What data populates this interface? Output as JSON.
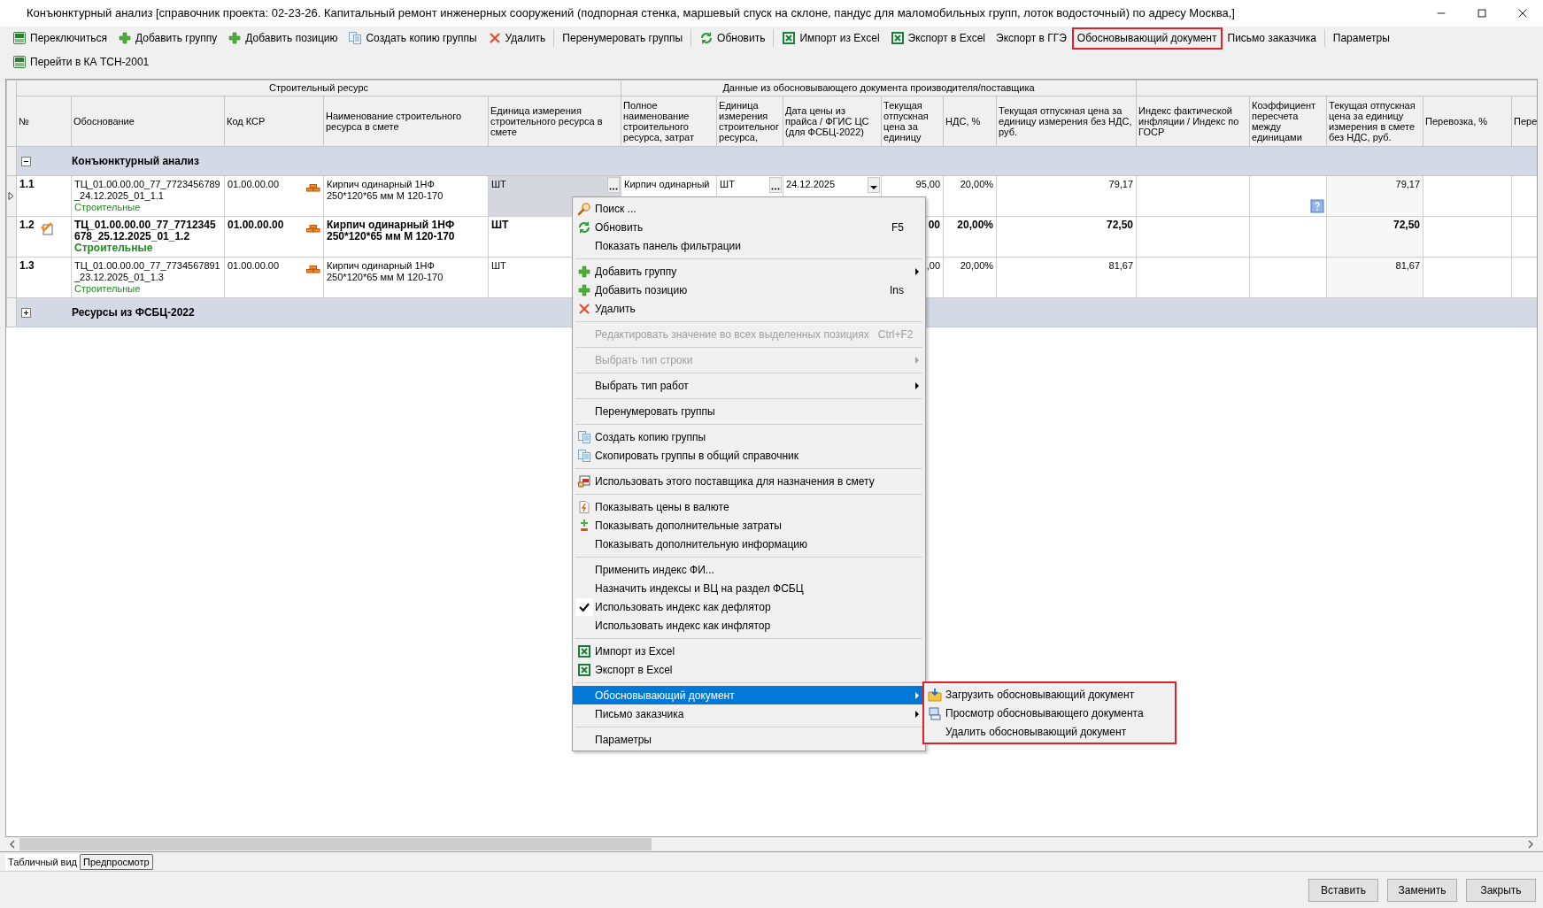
{
  "window": {
    "title": "Конъюнктурный анализ [справочник проекта: 02-23-26. Капитальный ремонт инженерных сооружений (подпорная стенка, маршевый спуск на склоне, пандус для маломобильных групп, лоток водосточный) по адресу Москва,]"
  },
  "toolbar_rows": [
    {
      "items": [
        {
          "kind": "button",
          "label": "Переключиться",
          "highlighted": false
        },
        {
          "kind": "button",
          "label": "Добавить группу",
          "highlighted": false
        },
        {
          "kind": "button",
          "label": "Добавить позицию",
          "highlighted": false
        },
        {
          "kind": "button",
          "label": "Создать копию группы",
          "highlighted": false
        },
        {
          "kind": "button",
          "label": "Удалить",
          "highlighted": false
        },
        {
          "kind": "separator"
        },
        {
          "kind": "button",
          "label": "Перенумеровать группы",
          "highlighted": false
        },
        {
          "kind": "separator"
        },
        {
          "kind": "button",
          "label": "Обновить",
          "highlighted": false
        },
        {
          "kind": "separator"
        },
        {
          "kind": "button",
          "label": "Импорт из Excel",
          "highlighted": false
        },
        {
          "kind": "button",
          "label": "Экспорт в Excel",
          "highlighted": false
        },
        {
          "kind": "button",
          "label": "Экспорт в ГГЭ",
          "highlighted": false
        },
        {
          "kind": "button",
          "label": "Обосновывающий документ",
          "highlighted": true
        },
        {
          "kind": "button",
          "label": "Письмо заказчика",
          "highlighted": false
        },
        {
          "kind": "separator"
        },
        {
          "kind": "button",
          "label": "Параметры",
          "highlighted": false
        }
      ]
    },
    {
      "items": [
        {
          "kind": "button",
          "label": "Перейти в КА ТСН-2001",
          "highlighted": false
        }
      ]
    }
  ],
  "grid": {
    "column_groups": [
      {
        "label": "Строительный ресурс",
        "columns": [
          "№",
          "Обоснование",
          "Код КСР",
          "Наименование строительного ресурса в смете",
          "Единица измерения строительного ресурса в смете"
        ]
      },
      {
        "label": "Данные из обосновывающего документа производителя/поставщика",
        "columns": [
          "Полное наименование строительного ресурса, затрат",
          "Единица измерения строительног ресурса,",
          "Дата цены из прайса / ФГИС ЦС (для ФСБЦ-2022)",
          "Текущая отпускная цена за единицу",
          "НДС, %",
          "Текущая отпускная цена за единицу измерения без НДС, руб."
        ]
      },
      {
        "columns": [
          "Индекс фактической инфляции / Индекс по ГОСР",
          "Коэффициент пересчета между единицами",
          "Текущая отпускная цена за единицу измерения в смете без НДС, руб.",
          "Перевозка, %",
          "Пере"
        ]
      }
    ],
    "rows": [
      {
        "kind": "group",
        "label": "Конъюнктурный анализ",
        "expanded": true
      },
      {
        "kind": "row",
        "current": true,
        "marked": false,
        "bold": false,
        "number": "1.1",
        "basis": "ТЦ_01.00.00.00_77_7723456789_24.12.2025_01_1.1",
        "category": "Строительные",
        "ksr_code": "01.00.00.00",
        "resource_name": "Кирпич одинарный 1НФ 250*120*65 мм М 120-170",
        "unit": "ШТ",
        "supplier_resource_name": "Кирпич одинарный",
        "supplier_unit": "ШТ",
        "price_date": "24.12.2025",
        "current_price": "95,00",
        "vat": "20,00%",
        "price_without_vat": "79,17",
        "price_in_estimate": "79,17"
      },
      {
        "kind": "row",
        "current": false,
        "marked": true,
        "bold": true,
        "number": "1.2",
        "basis": "ТЦ_01.00.00.00_77_7712345678_25.12.2025_01_1.2",
        "category": "Строительные",
        "ksr_code": "01.00.00.00",
        "resource_name": "Кирпич одинарный 1НФ 250*120*65 мм М 120-170",
        "unit": "ШТ",
        "current_price": "00",
        "vat": "20,00%",
        "price_without_vat": "72,50",
        "price_in_estimate": "72,50"
      },
      {
        "kind": "row",
        "current": false,
        "marked": false,
        "bold": false,
        "number": "1.3",
        "basis": "ТЦ_01.00.00.00_77_7734567891_23.12.2025_01_1.3",
        "category": "Строительные",
        "ksr_code": "01.00.00.00",
        "resource_name": "Кирпич одинарный 1НФ 250*120*65 мм М 120-170",
        "unit": "ШТ",
        "current_price": ",00",
        "vat": "20,00%",
        "price_without_vat": "81,67",
        "price_in_estimate": "81,67"
      },
      {
        "kind": "group",
        "label": "Ресурсы из ФСБЦ-2022",
        "expanded": false
      }
    ]
  },
  "context_menu": {
    "items": [
      {
        "kind": "item",
        "label": "Поиск ...",
        "disabled": false,
        "submenu": false,
        "checked": false,
        "selected": false
      },
      {
        "kind": "item",
        "label": "Обновить",
        "shortcut": "F5",
        "disabled": false,
        "submenu": false,
        "checked": false,
        "selected": false
      },
      {
        "kind": "item",
        "label": "Показать панель фильтрации",
        "disabled": false,
        "submenu": false,
        "checked": false,
        "selected": false
      },
      {
        "kind": "separator"
      },
      {
        "kind": "item",
        "label": "Добавить группу",
        "disabled": false,
        "submenu": true,
        "checked": false,
        "selected": false
      },
      {
        "kind": "item",
        "label": "Добавить позицию",
        "shortcut": "Ins",
        "disabled": false,
        "submenu": false,
        "checked": false,
        "selected": false
      },
      {
        "kind": "item",
        "label": "Удалить",
        "disabled": false,
        "submenu": false,
        "checked": false,
        "selected": false
      },
      {
        "kind": "separator"
      },
      {
        "kind": "item",
        "label": "Редактировать значение во всех выделенных позициях",
        "shortcut": "Ctrl+F2",
        "disabled": true,
        "submenu": false,
        "checked": false,
        "selected": false
      },
      {
        "kind": "separator"
      },
      {
        "kind": "item",
        "label": "Выбрать тип строки",
        "disabled": true,
        "submenu": true,
        "checked": false,
        "selected": false
      },
      {
        "kind": "separator"
      },
      {
        "kind": "item",
        "label": "Выбрать тип работ",
        "disabled": false,
        "submenu": true,
        "checked": false,
        "selected": false
      },
      {
        "kind": "separator"
      },
      {
        "kind": "item",
        "label": "Перенумеровать группы",
        "disabled": false,
        "submenu": false,
        "checked": false,
        "selected": false
      },
      {
        "kind": "separator"
      },
      {
        "kind": "item",
        "label": "Создать копию группы",
        "disabled": false,
        "submenu": false,
        "checked": false,
        "selected": false
      },
      {
        "kind": "item",
        "label": "Скопировать группы в общий справочник",
        "disabled": false,
        "submenu": false,
        "checked": false,
        "selected": false
      },
      {
        "kind": "separator"
      },
      {
        "kind": "item",
        "label": "Использовать этого поставщика для назначения в смету",
        "disabled": false,
        "submenu": false,
        "checked": false,
        "selected": false
      },
      {
        "kind": "separator"
      },
      {
        "kind": "item",
        "label": "Показывать цены в валюте",
        "disabled": false,
        "submenu": false,
        "checked": false,
        "selected": false
      },
      {
        "kind": "item",
        "label": "Показывать дополнительные затраты",
        "disabled": false,
        "submenu": false,
        "checked": false,
        "selected": false
      },
      {
        "kind": "item",
        "label": "Показывать дополнительную информацию",
        "disabled": false,
        "submenu": false,
        "checked": false,
        "selected": false
      },
      {
        "kind": "separator"
      },
      {
        "kind": "item",
        "label": "Применить индекс ФИ...",
        "disabled": false,
        "submenu": false,
        "checked": false,
        "selected": false
      },
      {
        "kind": "item",
        "label": "Назначить индексы и ВЦ на раздел ФСБЦ",
        "disabled": false,
        "submenu": false,
        "checked": false,
        "selected": false
      },
      {
        "kind": "item",
        "label": "Использовать индекс как дефлятор",
        "disabled": false,
        "submenu": false,
        "checked": true,
        "selected": false
      },
      {
        "kind": "item",
        "label": "Использовать индекс как инфлятор",
        "disabled": false,
        "submenu": false,
        "checked": false,
        "selected": false
      },
      {
        "kind": "separator"
      },
      {
        "kind": "item",
        "label": "Импорт из Excel",
        "disabled": false,
        "submenu": false,
        "checked": false,
        "selected": false
      },
      {
        "kind": "item",
        "label": "Экспорт в Excel",
        "disabled": false,
        "submenu": false,
        "checked": false,
        "selected": false
      },
      {
        "kind": "separator"
      },
      {
        "kind": "item",
        "label": "Обосновывающий документ",
        "disabled": false,
        "submenu": true,
        "checked": false,
        "selected": true
      },
      {
        "kind": "item",
        "label": "Письмо заказчика",
        "disabled": false,
        "submenu": true,
        "checked": false,
        "selected": false
      },
      {
        "kind": "separator"
      },
      {
        "kind": "item",
        "label": "Параметры",
        "disabled": false,
        "submenu": false,
        "checked": false,
        "selected": false
      }
    ]
  },
  "submenu": {
    "highlighted": true,
    "items": [
      {
        "label": "Загрузить обосновывающий документ"
      },
      {
        "label": "Просмотр обосновывающего документа"
      },
      {
        "label": "Удалить обосновывающий документ"
      }
    ]
  },
  "view_tabs": [
    {
      "label": "Табличный вид",
      "selected": true
    },
    {
      "label": "Предпросмотр",
      "selected": false
    }
  ],
  "buttons": [
    "Вставить",
    "Заменить",
    "Закрыть"
  ]
}
